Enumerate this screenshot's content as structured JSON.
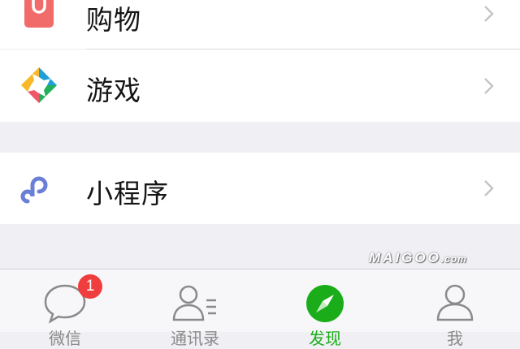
{
  "menu": {
    "items": [
      {
        "label": "购物",
        "icon": "shopping-bag-icon"
      },
      {
        "label": "游戏",
        "icon": "game-icon"
      },
      {
        "label": "小程序",
        "icon": "mini-program-icon"
      }
    ]
  },
  "tabbar": {
    "tabs": [
      {
        "label": "微信",
        "icon": "chat-bubble-icon",
        "badge": "1"
      },
      {
        "label": "通讯录",
        "icon": "contacts-icon"
      },
      {
        "label": "发现",
        "icon": "compass-icon",
        "active": true
      },
      {
        "label": "我",
        "icon": "profile-icon"
      }
    ]
  },
  "watermark": {
    "brand": "MAIGOO",
    "suffix": ".com"
  },
  "colors": {
    "active_green": "#1aad19",
    "badge_red": "#f03d3d",
    "shopping_red": "#f26b6b",
    "mini_program_blue": "#6b7fd7"
  }
}
